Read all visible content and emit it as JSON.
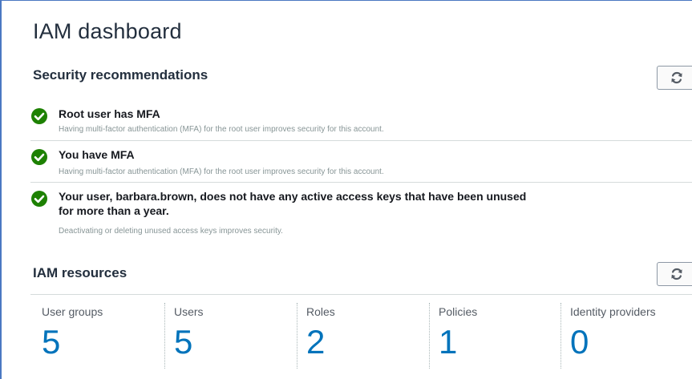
{
  "page": {
    "title": "IAM dashboard"
  },
  "security": {
    "title": "Security recommendations",
    "refresh_icon": "refresh-icon",
    "items": [
      {
        "title": "Root user has MFA",
        "description": "Having multi-factor authentication (MFA) for the root user improves security for this account.",
        "status": "ok",
        "icon": "check-circle-icon"
      },
      {
        "title": "You have MFA",
        "description": "Having multi-factor authentication (MFA) for the root user improves security for this account.",
        "status": "ok",
        "icon": "check-circle-icon"
      },
      {
        "title": "Your user, barbara.brown, does not have any active access keys that have been unused for more than a year.",
        "description": "Deactivating or deleting unused access keys improves security.",
        "status": "ok",
        "icon": "check-circle-icon"
      }
    ]
  },
  "resources": {
    "title": "IAM resources",
    "refresh_icon": "refresh-icon",
    "items": [
      {
        "label": "User groups",
        "value": "5"
      },
      {
        "label": "Users",
        "value": "5"
      },
      {
        "label": "Roles",
        "value": "2"
      },
      {
        "label": "Policies",
        "value": "1"
      },
      {
        "label": "Identity providers",
        "value": "0"
      }
    ]
  },
  "colors": {
    "success": "#1d8102",
    "link": "#0073bb",
    "heading": "#232f3e",
    "muted": "#879596",
    "frame_border": "#4a78c2"
  }
}
